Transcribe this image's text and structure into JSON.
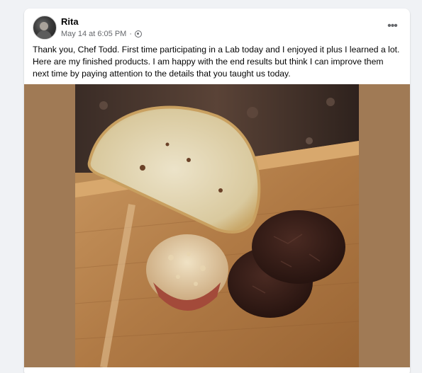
{
  "post": {
    "author": "Rita",
    "timestamp": "May 14 at 6:05 PM",
    "separator": "·",
    "privacy_icon": "globe-icon",
    "more_label": "•••",
    "text": "Thank you, Chef Todd. First time participating in a Lab today and I enjoyed it plus I learned a lot. Here are my finished products. I am happy with the end results but think I can improve them next time by paying attention to the details that you taught us today."
  },
  "photo": {
    "background_color": "#a07a55"
  }
}
